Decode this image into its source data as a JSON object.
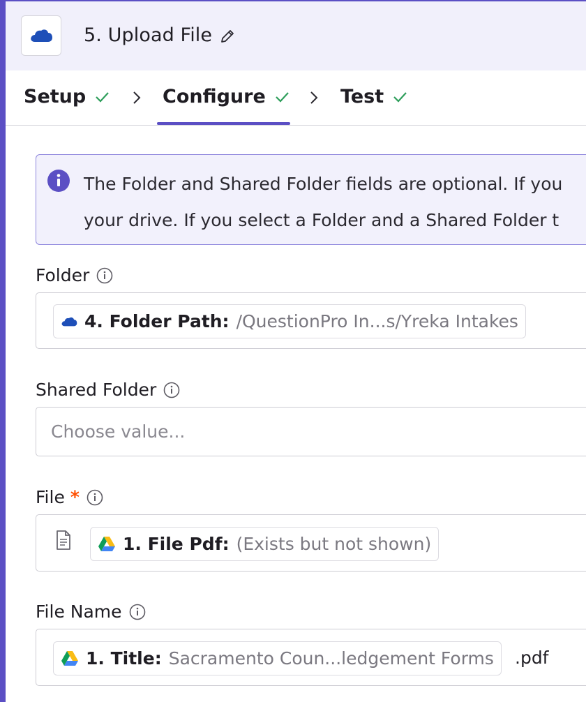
{
  "header": {
    "step_title": "5. Upload File"
  },
  "tabs": [
    {
      "label": "Setup"
    },
    {
      "label": "Configure"
    },
    {
      "label": "Test"
    }
  ],
  "info": {
    "line1": "The Folder and Shared Folder fields are optional. If you",
    "line2": "your drive. If you select a Folder and a Shared Folder t"
  },
  "fields": {
    "folder": {
      "label": "Folder",
      "pill_label": "4. Folder Path:",
      "pill_value": "/QuestionPro In...s/Yreka Intakes"
    },
    "shared_folder": {
      "label": "Shared Folder",
      "placeholder": "Choose value..."
    },
    "file": {
      "label": "File",
      "required_mark": "*",
      "pill_label": "1. File Pdf:",
      "pill_value": "(Exists but not shown)"
    },
    "file_name": {
      "label": "File Name",
      "pill_label": "1. Title:",
      "pill_value": "Sacramento Coun...ledgement Forms",
      "suffix": ".pdf"
    }
  },
  "icons": {
    "onedrive": "onedrive-cloud-icon",
    "gdrive": "google-drive-icon",
    "check": "check-icon",
    "info": "info-icon",
    "edit": "pencil-icon",
    "document": "document-icon"
  },
  "colors": {
    "accent": "#5b4fc4",
    "success": "#2e9e5b",
    "required": "#ff4f00",
    "onedrive": "#1e4fb8"
  }
}
